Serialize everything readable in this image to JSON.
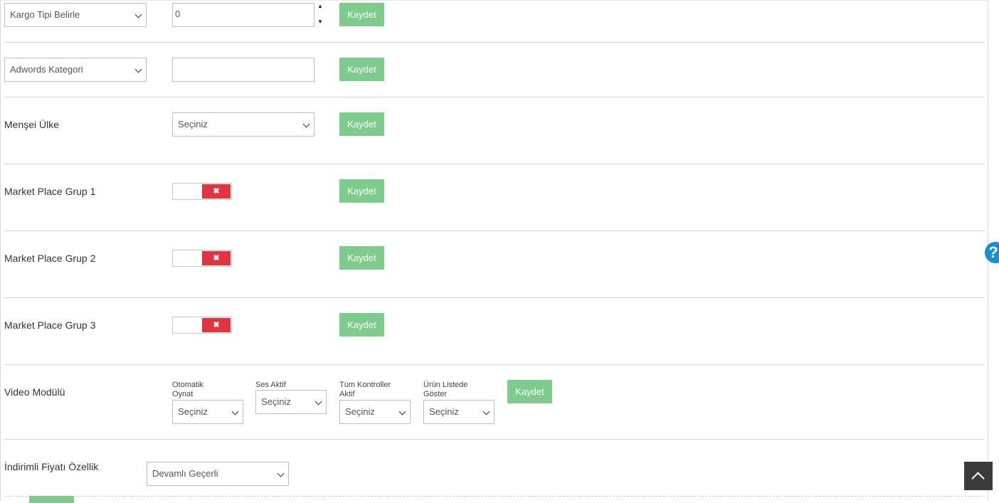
{
  "rows": {
    "kargo": {
      "select": "Kargo Tipi Belirle",
      "input_value": "0",
      "save": "Kaydet"
    },
    "adwords": {
      "select": "Adwords Kategori",
      "input_value": "",
      "save": "Kaydet"
    },
    "mensei": {
      "label": "Menşei Ülke",
      "select": "Seçiniz",
      "save": "Kaydet"
    },
    "mp1": {
      "label": "Market Place Grup 1",
      "toggle": "✖",
      "save": "Kaydet"
    },
    "mp2": {
      "label": "Market Place Grup 2",
      "toggle": "✖",
      "save": "Kaydet"
    },
    "mp3": {
      "label": "Market Place Grup 3",
      "toggle": "✖",
      "save": "Kaydet"
    },
    "video": {
      "label": "Video Modülü",
      "otomatik": {
        "label_line1": "Otomatik",
        "label_line2": "Oynat",
        "select": "Seçiniz"
      },
      "ses": {
        "label": "Ses Aktif",
        "select": "Seçiniz"
      },
      "kontroller": {
        "label_line1": "Tüm Kontroller",
        "label_line2": "Aktif",
        "select": "Seçiniz"
      },
      "listede": {
        "label_line1": "Ürün Listede",
        "label_line2": "Göster",
        "select": "Seçiniz"
      },
      "save": "Kaydet"
    },
    "indirim": {
      "label": "İndirimli Fiyatı Özellik",
      "select": "Devamlı Geçerli"
    }
  },
  "help_icon": "?",
  "scroll_top_icon": "chevron-up-icon"
}
